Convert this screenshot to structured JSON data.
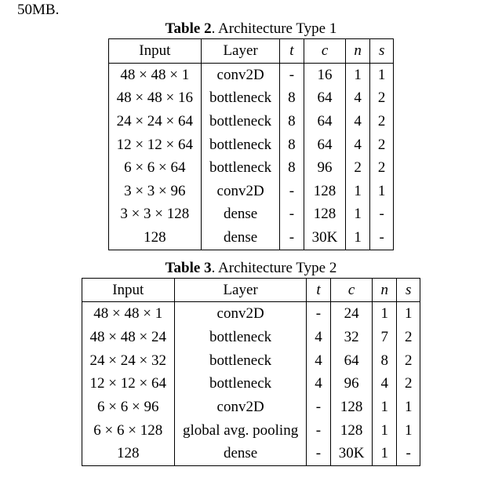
{
  "leading_fragment": "50MB.",
  "table2": {
    "caption_bold": "Table 2",
    "caption_rest": ". Architecture Type 1",
    "headers": [
      "Input",
      "Layer",
      "t",
      "c",
      "n",
      "s"
    ],
    "rows": [
      [
        "48 × 48 × 1",
        "conv2D",
        "-",
        "16",
        "1",
        "1"
      ],
      [
        "48 × 48 × 16",
        "bottleneck",
        "8",
        "64",
        "4",
        "2"
      ],
      [
        "24 × 24 × 64",
        "bottleneck",
        "8",
        "64",
        "4",
        "2"
      ],
      [
        "12 × 12 × 64",
        "bottleneck",
        "8",
        "64",
        "4",
        "2"
      ],
      [
        "6 × 6 × 64",
        "bottleneck",
        "8",
        "96",
        "2",
        "2"
      ],
      [
        "3 × 3 × 96",
        "conv2D",
        "-",
        "128",
        "1",
        "1"
      ],
      [
        "3 × 3 × 128",
        "dense",
        "-",
        "128",
        "1",
        "-"
      ],
      [
        "128",
        "dense",
        "-",
        "30K",
        "1",
        "-"
      ]
    ]
  },
  "table3": {
    "caption_bold": "Table 3",
    "caption_rest": ". Architecture Type 2",
    "headers": [
      "Input",
      "Layer",
      "t",
      "c",
      "n",
      "s"
    ],
    "rows": [
      [
        "48 × 48 × 1",
        "conv2D",
        "-",
        "24",
        "1",
        "1"
      ],
      [
        "48 × 48 × 24",
        "bottleneck",
        "4",
        "32",
        "7",
        "2"
      ],
      [
        "24 × 24 × 32",
        "bottleneck",
        "4",
        "64",
        "8",
        "2"
      ],
      [
        "12 × 12 × 64",
        "bottleneck",
        "4",
        "96",
        "4",
        "2"
      ],
      [
        "6 × 6 × 96",
        "conv2D",
        "-",
        "128",
        "1",
        "1"
      ],
      [
        "6 × 6 × 128",
        "global avg. pooling",
        "-",
        "128",
        "1",
        "1"
      ],
      [
        "128",
        "dense",
        "-",
        "30K",
        "1",
        "-"
      ]
    ]
  },
  "chart_data": [
    {
      "type": "table",
      "title": "Architecture Type 1",
      "columns": [
        "Input",
        "Layer",
        "t",
        "c",
        "n",
        "s"
      ],
      "rows": [
        [
          "48×48×1",
          "conv2D",
          null,
          16,
          1,
          1
        ],
        [
          "48×48×16",
          "bottleneck",
          8,
          64,
          4,
          2
        ],
        [
          "24×24×64",
          "bottleneck",
          8,
          64,
          4,
          2
        ],
        [
          "12×12×64",
          "bottleneck",
          8,
          64,
          4,
          2
        ],
        [
          "6×6×64",
          "bottleneck",
          8,
          96,
          2,
          2
        ],
        [
          "3×3×96",
          "conv2D",
          null,
          128,
          1,
          1
        ],
        [
          "3×3×128",
          "dense",
          null,
          128,
          1,
          null
        ],
        [
          "128",
          "dense",
          null,
          "30K",
          1,
          null
        ]
      ]
    },
    {
      "type": "table",
      "title": "Architecture Type 2",
      "columns": [
        "Input",
        "Layer",
        "t",
        "c",
        "n",
        "s"
      ],
      "rows": [
        [
          "48×48×1",
          "conv2D",
          null,
          24,
          1,
          1
        ],
        [
          "48×48×24",
          "bottleneck",
          4,
          32,
          7,
          2
        ],
        [
          "24×24×32",
          "bottleneck",
          4,
          64,
          8,
          2
        ],
        [
          "12×12×64",
          "bottleneck",
          4,
          96,
          4,
          2
        ],
        [
          "6×6×96",
          "conv2D",
          null,
          128,
          1,
          1
        ],
        [
          "6×6×128",
          "global avg. pooling",
          null,
          128,
          1,
          1
        ],
        [
          "128",
          "dense",
          null,
          "30K",
          1,
          null
        ]
      ]
    }
  ]
}
